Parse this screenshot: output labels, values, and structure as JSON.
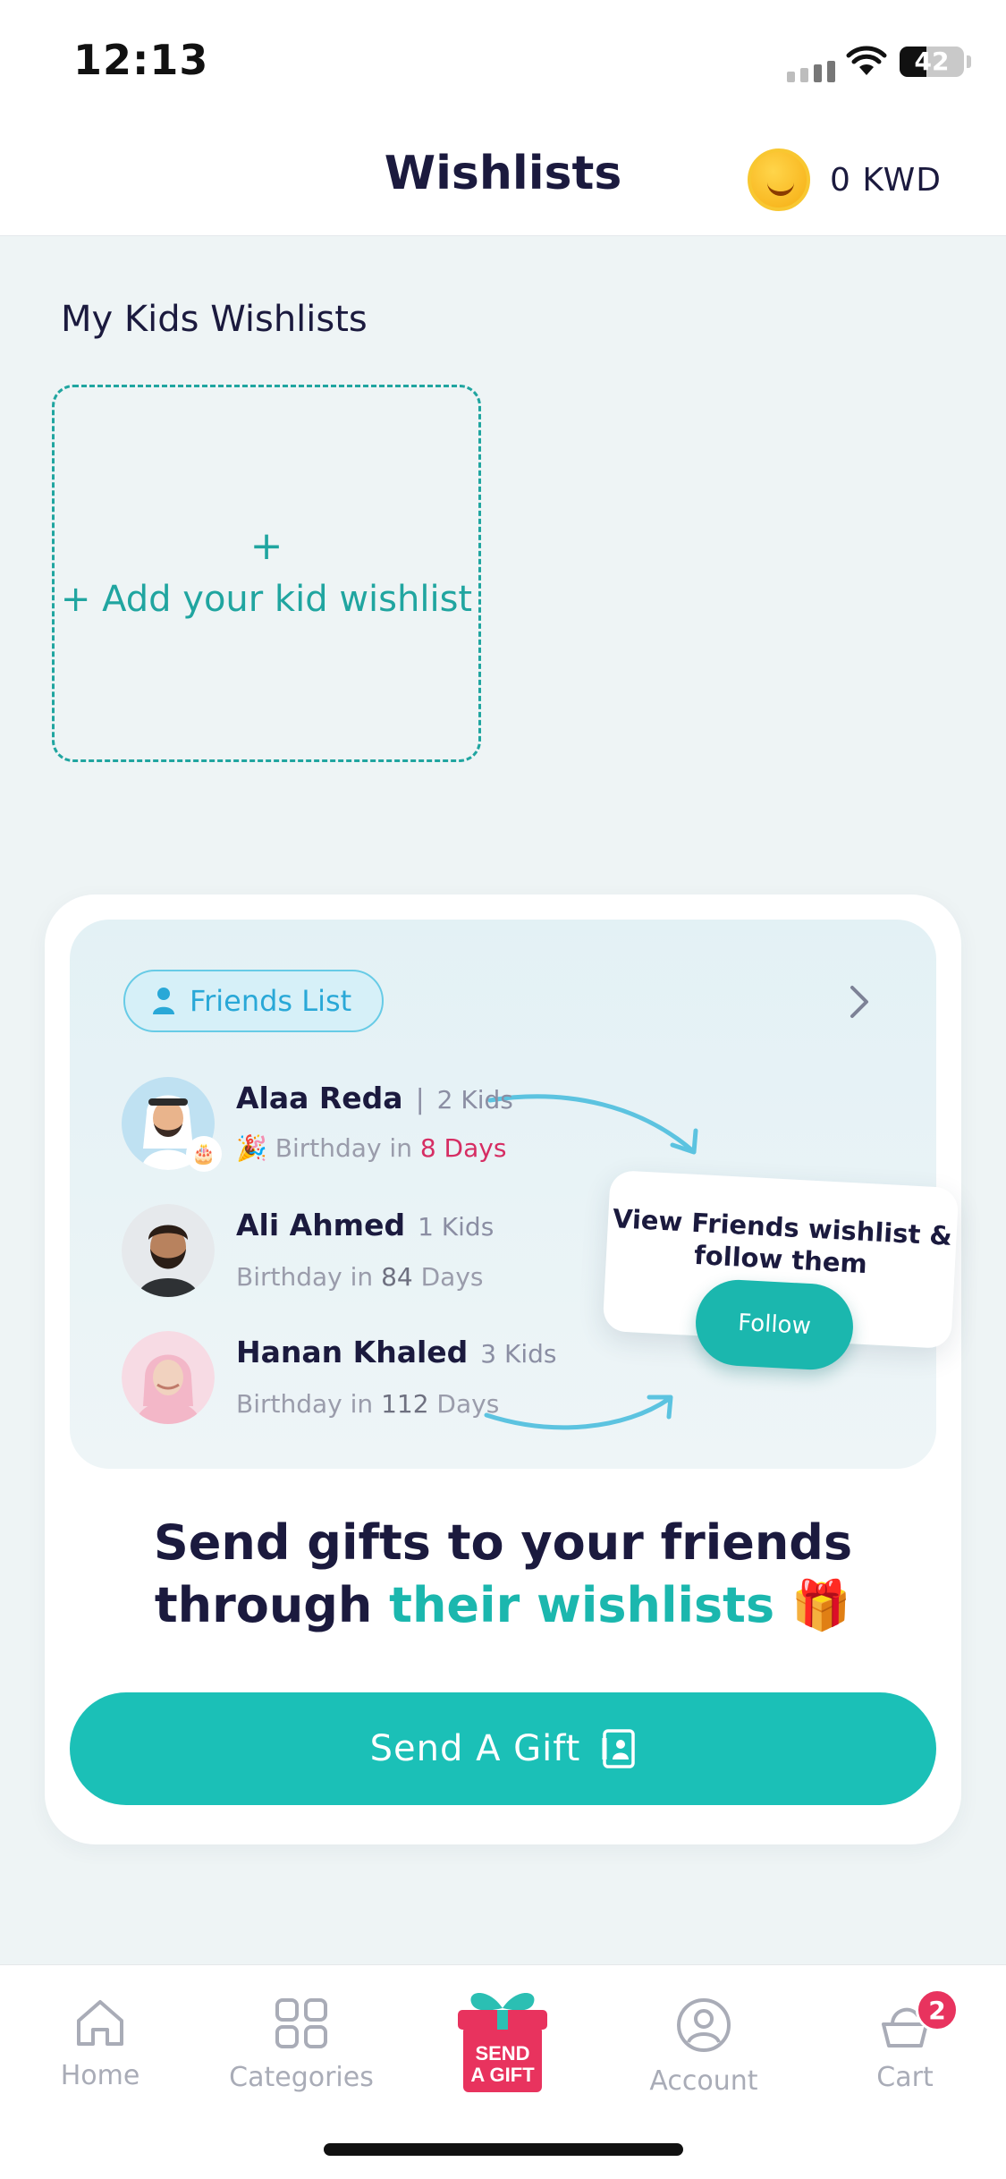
{
  "status_bar": {
    "time": "12:13",
    "battery": "42",
    "battery_level": 0.42
  },
  "header": {
    "title": "Wishlists",
    "wallet_amount": "0 KWD",
    "wallet_icon": "smiley-coin-icon"
  },
  "kids": {
    "section_title": "My Kids Wishlists",
    "add_plus": "+",
    "add_label": "+ Add your kid wishlist"
  },
  "promo": {
    "friends_pill": "Friends List",
    "friends": [
      {
        "name": "Alaa Reda",
        "separator": "|",
        "kids": "2 Kids",
        "birthday_prefix": "Birthday in",
        "birthday_value": "8 Days",
        "emoji": "🎉"
      },
      {
        "name": "Ali Ahmed",
        "kids": "1 Kids",
        "birthday_prefix": "Birthday in",
        "birthday_value": "84",
        "birthday_suffix": "Days"
      },
      {
        "name": "Hanan Khaled",
        "kids": "3 Kids",
        "birthday_prefix": "Birthday in",
        "birthday_value": "112",
        "birthday_suffix": "Days"
      }
    ],
    "tip_line1": "View Friends wishlist &",
    "tip_line2": "follow them",
    "follow_button": "Follow",
    "headline_line1": "Send gifts to your friends",
    "headline_line2_plain": "through",
    "headline_line2_accent": "their wishlists",
    "headline_emoji": "🎁",
    "cta": "Send A Gift"
  },
  "nav": {
    "items": [
      {
        "label": "Home",
        "icon": "home-icon"
      },
      {
        "label": "Categories",
        "icon": "grid-icon"
      },
      {
        "label": "SEND A GIFT",
        "icon": "gift-box-icon"
      },
      {
        "label": "Account",
        "icon": "user-circle-icon"
      },
      {
        "label": "Cart",
        "icon": "cart-icon"
      }
    ],
    "send_gift_line1": "SEND",
    "send_gift_line2": "A GIFT",
    "cart_badge": "2"
  },
  "colors": {
    "accent": "#1bb7ae",
    "brand_dark": "#1b1a3e",
    "highlight": "#d62d63",
    "badge": "#e8335e"
  }
}
